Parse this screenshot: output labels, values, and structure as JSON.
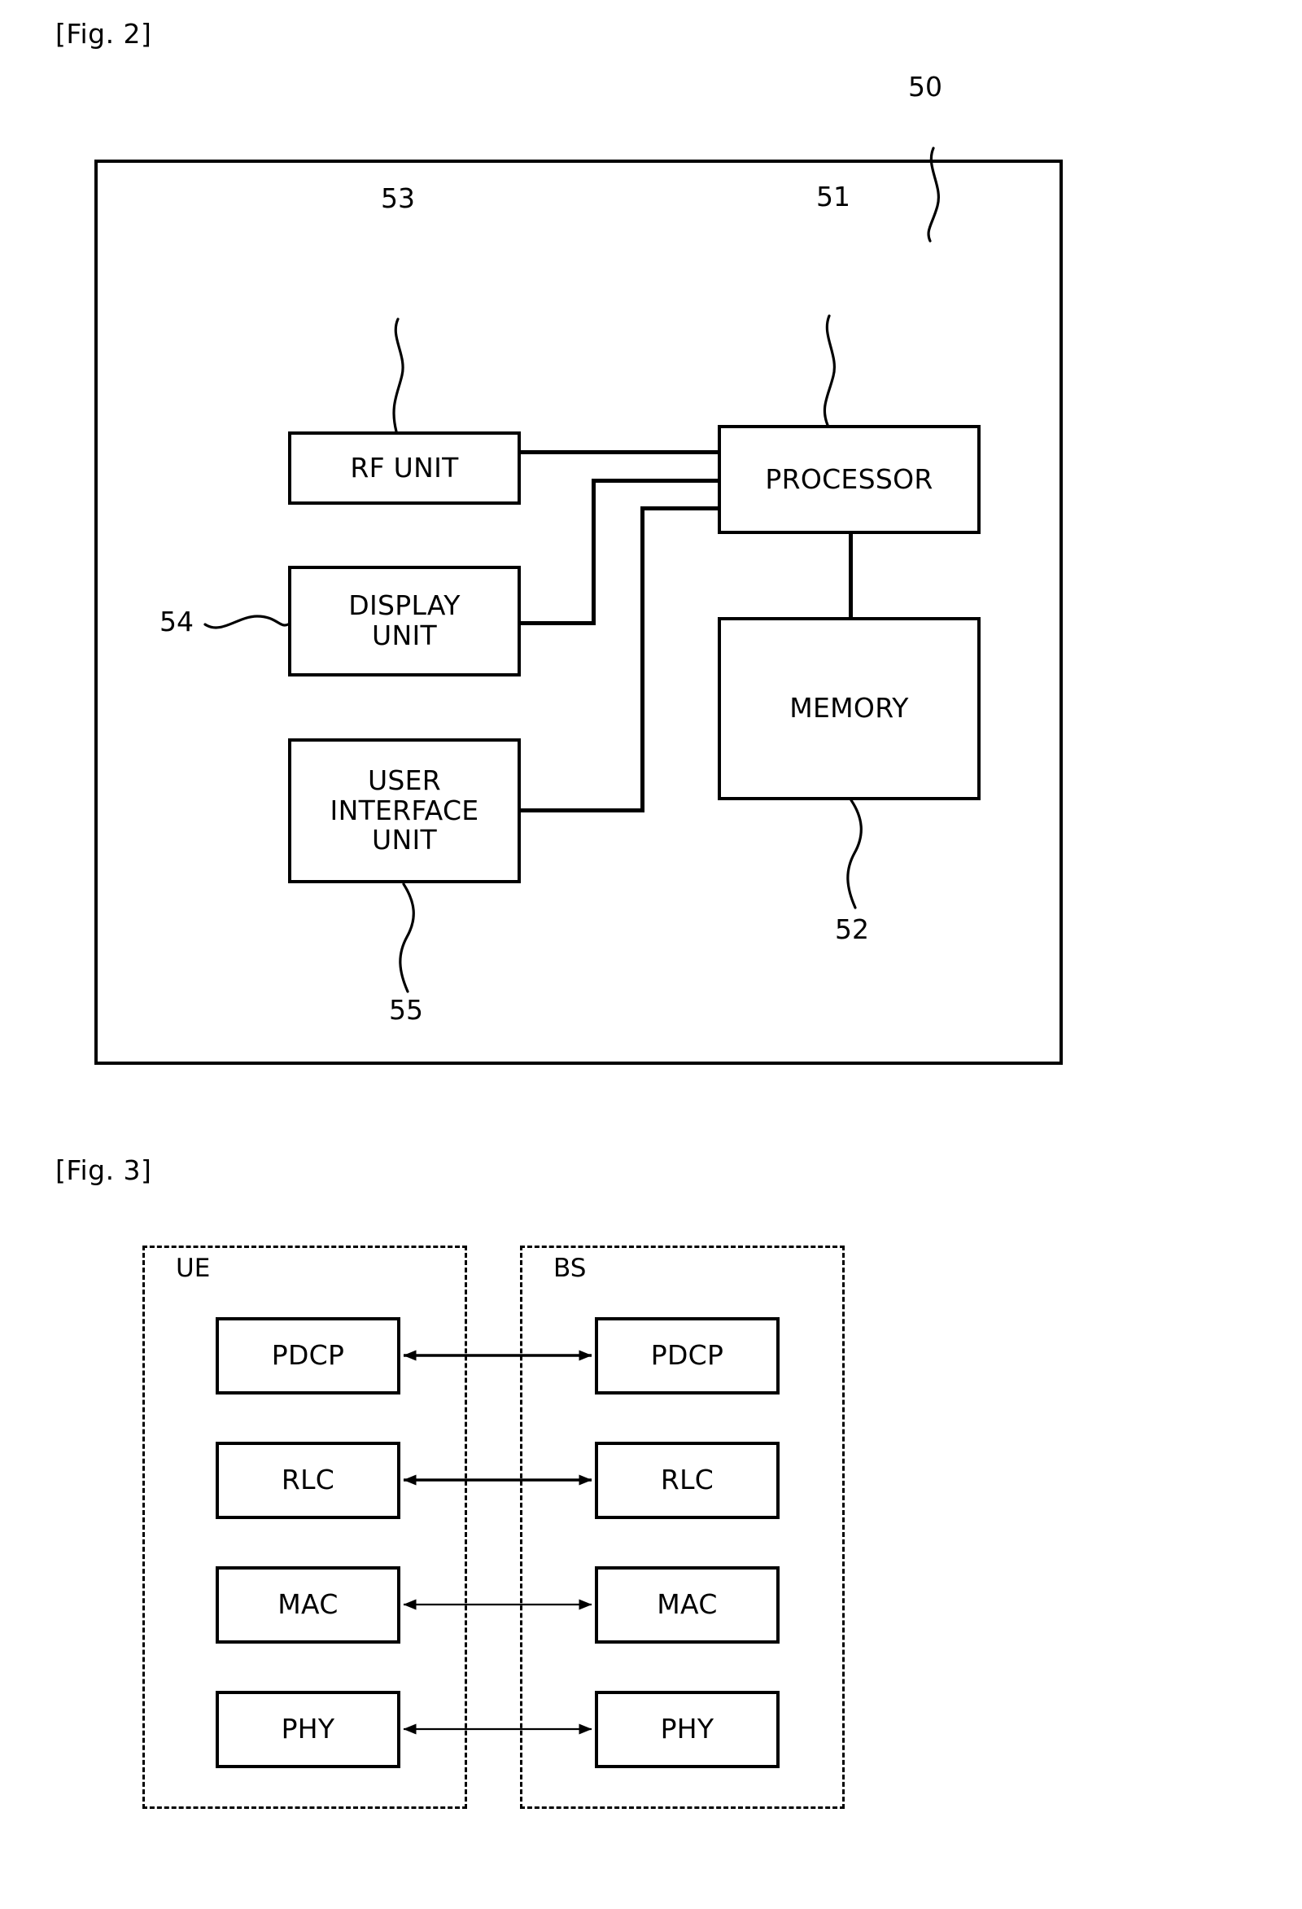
{
  "figures": [
    {
      "caption": "[Fig. 2]",
      "title_ref": "50",
      "blocks": [
        {
          "id": "rf-unit",
          "label": "RF UNIT",
          "ref": "53"
        },
        {
          "id": "display",
          "label": "DISPLAY\nUNIT",
          "ref": "54"
        },
        {
          "id": "ui-unit",
          "label": "USER\nINTERFACE\nUNIT",
          "ref": "55"
        },
        {
          "id": "processor",
          "label": "PROCESSOR",
          "ref": "51"
        },
        {
          "id": "memory",
          "label": "MEMORY",
          "ref": "52"
        }
      ],
      "reference_numerals": {
        "device": "50",
        "processor": "51",
        "memory": "52",
        "rf_unit": "53",
        "display_unit": "54",
        "user_interface_unit": "55"
      }
    },
    {
      "caption": "[Fig. 3]",
      "groups": [
        {
          "id": "ue",
          "label": "UE"
        },
        {
          "id": "bs",
          "label": "BS"
        }
      ],
      "layers": [
        {
          "name": "PDCP"
        },
        {
          "name": "RLC"
        },
        {
          "name": "MAC"
        },
        {
          "name": "PHY"
        }
      ],
      "ue_layers": [
        "PDCP",
        "RLC",
        "MAC",
        "PHY"
      ],
      "bs_layers": [
        "PDCP",
        "RLC",
        "MAC",
        "PHY"
      ]
    }
  ],
  "fig2": {
    "caption": "[Fig. 2]",
    "device_ref": "50",
    "rf_unit_label": "RF UNIT",
    "rf_unit_ref": "53",
    "display_unit_label": "DISPLAY\nUNIT",
    "display_unit_ref": "54",
    "ui_unit_label": "USER\nINTERFACE\nUNIT",
    "ui_unit_ref": "55",
    "processor_label": "PROCESSOR",
    "processor_ref": "51",
    "memory_label": "MEMORY",
    "memory_ref": "52"
  },
  "fig3": {
    "caption": "[Fig. 3]",
    "ue_label": "UE",
    "bs_label": "BS",
    "ue": {
      "pdcp": "PDCP",
      "rlc": "RLC",
      "mac": "MAC",
      "phy": "PHY"
    },
    "bs": {
      "pdcp": "PDCP",
      "rlc": "RLC",
      "mac": "MAC",
      "phy": "PHY"
    }
  },
  "colors": {
    "stroke": "#000000",
    "background": "#ffffff"
  }
}
